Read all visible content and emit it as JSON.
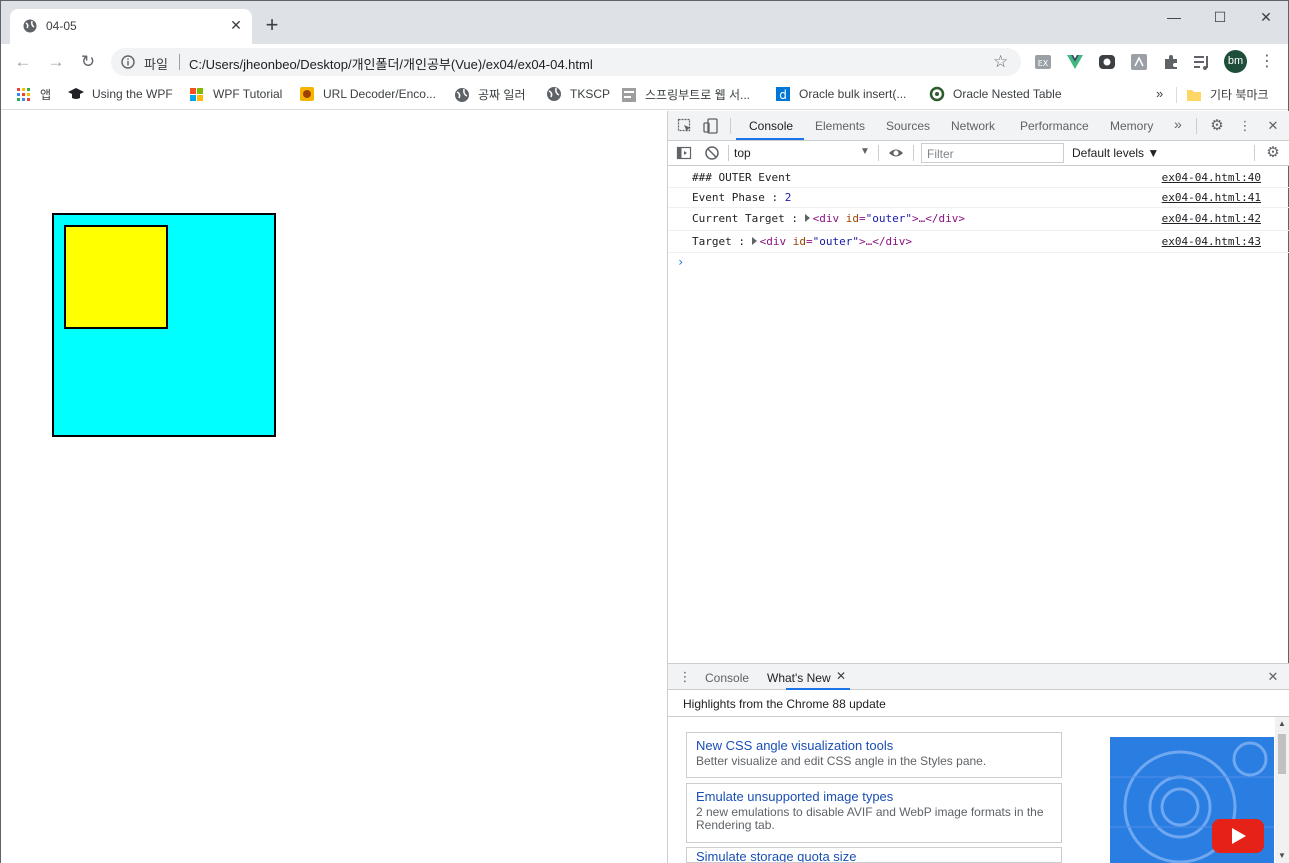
{
  "browser": {
    "tab_title": "04-05",
    "tab_close": "✕",
    "new_tab": "+",
    "scheme_label": "파일",
    "url": "C:/Users/jheonbeo/Desktop/개인폴더/개인공부(Vue)/ex04/ex04-04.html",
    "avatar_initials": "bm",
    "bookmarks": [
      {
        "label": "앱",
        "icon": "apps-grid-icon"
      },
      {
        "label": "Using the WPF",
        "icon": "graduation-cap-icon"
      },
      {
        "label": "WPF Tutorial",
        "icon": "windows-logo-icon"
      },
      {
        "label": "URL Decoder/Enco...",
        "icon": "site-favicon-icon"
      },
      {
        "label": "공짜 일러",
        "icon": "globe-icon"
      },
      {
        "label": "TKSCP",
        "icon": "globe-icon"
      },
      {
        "label": "스프링부트로 웹 서...",
        "icon": "site-favicon-icon"
      },
      {
        "label": "Oracle bulk insert(...",
        "icon": "d-logo-icon"
      },
      {
        "label": "Oracle Nested Table",
        "icon": "ring-icon"
      }
    ],
    "bookmarks_overflow": "»",
    "other_bookmarks": "기타 북마크"
  },
  "page": {
    "outer_color": "#00ffff",
    "inner_color": "#ffff00"
  },
  "devtools": {
    "tabs": [
      "Console",
      "Elements",
      "Sources",
      "Network",
      "Performance",
      "Memory"
    ],
    "more_tabs": "»",
    "context": "top",
    "filter_placeholder": "Filter",
    "levels": "Default levels ▼",
    "console_lines": [
      {
        "text": "### OUTER Event",
        "source": "ex04-04.html:40"
      },
      {
        "label": "Event Phase : ",
        "value": "2",
        "source": "ex04-04.html:41"
      },
      {
        "label": "Current Target : ",
        "tag_open": "<div ",
        "attr": "id",
        "eq": "=",
        "attr_val": "\"outer\"",
        "ellipsis": ">…",
        "tag_close": "</div>",
        "source": "ex04-04.html:42"
      },
      {
        "label": "Target : ",
        "tag_open": "<div ",
        "attr": "id",
        "eq": "=",
        "attr_val": "\"outer\"",
        "ellipsis": ">…",
        "tag_close": "</div>",
        "source": "ex04-04.html:43"
      }
    ],
    "prompt": "›",
    "drawer": {
      "tabs": [
        "Console",
        "What's New"
      ],
      "close_tab": "✕",
      "highlights": "Highlights from the Chrome 88 update",
      "cards": [
        {
          "title": "New CSS angle visualization tools",
          "desc": "Better visualize and edit CSS angle in the Styles pane."
        },
        {
          "title": "Emulate unsupported image types",
          "desc": "2 new emulations to disable AVIF and WebP image formats in the Rendering tab."
        },
        {
          "title": "Simulate storage quota size",
          "desc": ""
        }
      ]
    }
  }
}
